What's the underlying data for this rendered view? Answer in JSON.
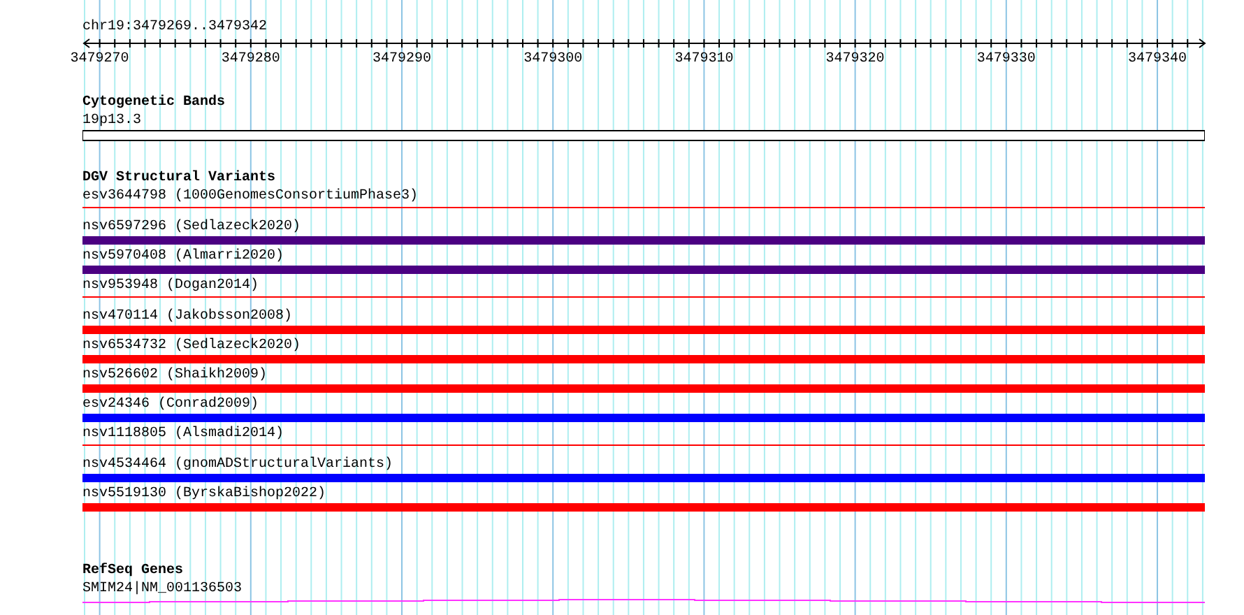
{
  "ruler": {
    "range": "chr19:3479269..3479342",
    "ticks": [
      "3479270",
      "3479280",
      "3479290",
      "3479300",
      "3479310",
      "3479320",
      "3479330",
      "3479340"
    ]
  },
  "tracks": [
    {
      "title": "Cytogenetic Bands",
      "kind": "cytoband",
      "features": [
        {
          "label": "19p13.3"
        }
      ]
    },
    {
      "title": "DGV Structural Variants",
      "kind": "variants",
      "features": [
        {
          "label": "esv3644798 (1000GenomesConsortiumPhase3)",
          "kind": "thin",
          "color": "#ff0000"
        },
        {
          "label": "nsv6597296 (Sedlazeck2020)",
          "kind": "thick",
          "color": "#4b0082"
        },
        {
          "label": "nsv5970408 (Almarri2020)",
          "kind": "thick",
          "color": "#4b0082"
        },
        {
          "label": "nsv953948 (Dogan2014)",
          "kind": "thin",
          "color": "#ff0000"
        },
        {
          "label": "nsv470114 (Jakobsson2008)",
          "kind": "thick",
          "color": "#ff0000"
        },
        {
          "label": "nsv6534732 (Sedlazeck2020)",
          "kind": "thick",
          "color": "#ff0000"
        },
        {
          "label": "nsv526602 (Shaikh2009)",
          "kind": "thick",
          "color": "#ff0000"
        },
        {
          "label": "esv24346 (Conrad2009)",
          "kind": "thick",
          "color": "#0000ff"
        },
        {
          "label": "nsv1118805 (Alsmadi2014)",
          "kind": "thin",
          "color": "#ff0000"
        },
        {
          "label": "nsv4534464 (gnomADStructuralVariants)",
          "kind": "thick",
          "color": "#0000ff"
        },
        {
          "label": "nsv5519130 (ByrskaBishop2022)",
          "kind": "thick",
          "color": "#ff0000"
        }
      ]
    },
    {
      "title": "RefSeq Genes",
      "kind": "gene",
      "features": [
        {
          "label": "SMIM24|NM_001136503"
        }
      ]
    }
  ]
}
